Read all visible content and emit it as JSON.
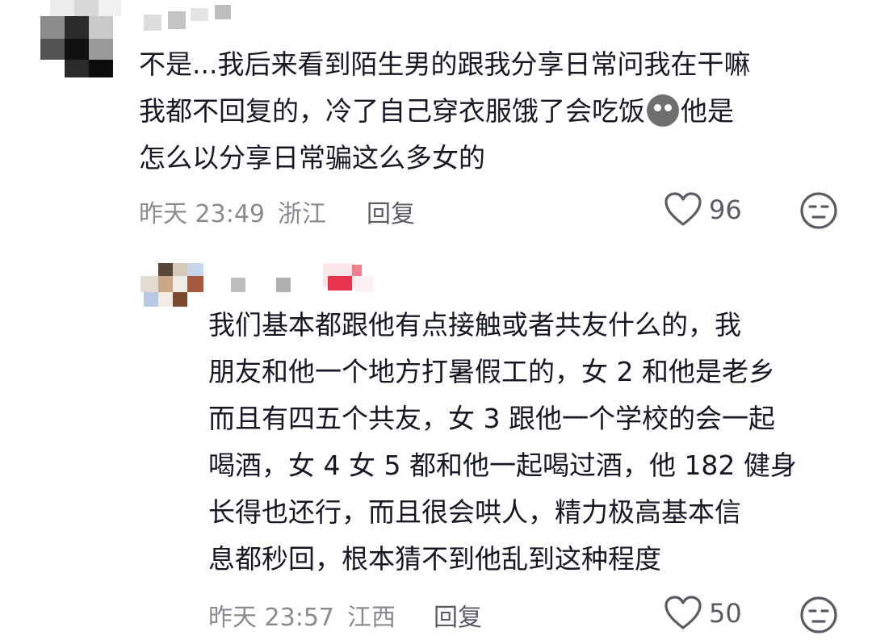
{
  "comments": [
    {
      "lines": [
        "不是...我后来看到陌生男的跟我分享日常问我在干嘛",
        "我都不回复的，冷了自己穿衣服饿了会吃饭",
        "怎么以分享日常骗这么多女的"
      ],
      "line2_suffix": "他是",
      "time": "昨天 23:49",
      "location": "浙江",
      "reply_label": "回复",
      "likes": "96"
    },
    {
      "lines": [
        "我们基本都跟他有点接触或者共友什么的，我",
        "朋友和他一个地方打暑假工的，女 2 和他是老乡",
        "而且有四五个共友，女 3 跟他一个学校的会一起",
        "喝酒，女 4 女 5 都和他一起喝过酒，他 182 健身",
        "长得也还行，而且很会哄人，精力极高基本信",
        "息都秒回，根本猜不到他乱到这种程度"
      ],
      "time": "昨天 23:57",
      "location": "江西",
      "reply_label": "回复",
      "likes": "50"
    }
  ],
  "icons": {
    "like": "heart-outline-icon",
    "dislike": "neutral-face-icon",
    "inline_emoji": "sad-face-emoji-icon"
  },
  "colors": {
    "text": "#161823",
    "meta": "#8a8b91",
    "icon": "#5b5c63"
  }
}
